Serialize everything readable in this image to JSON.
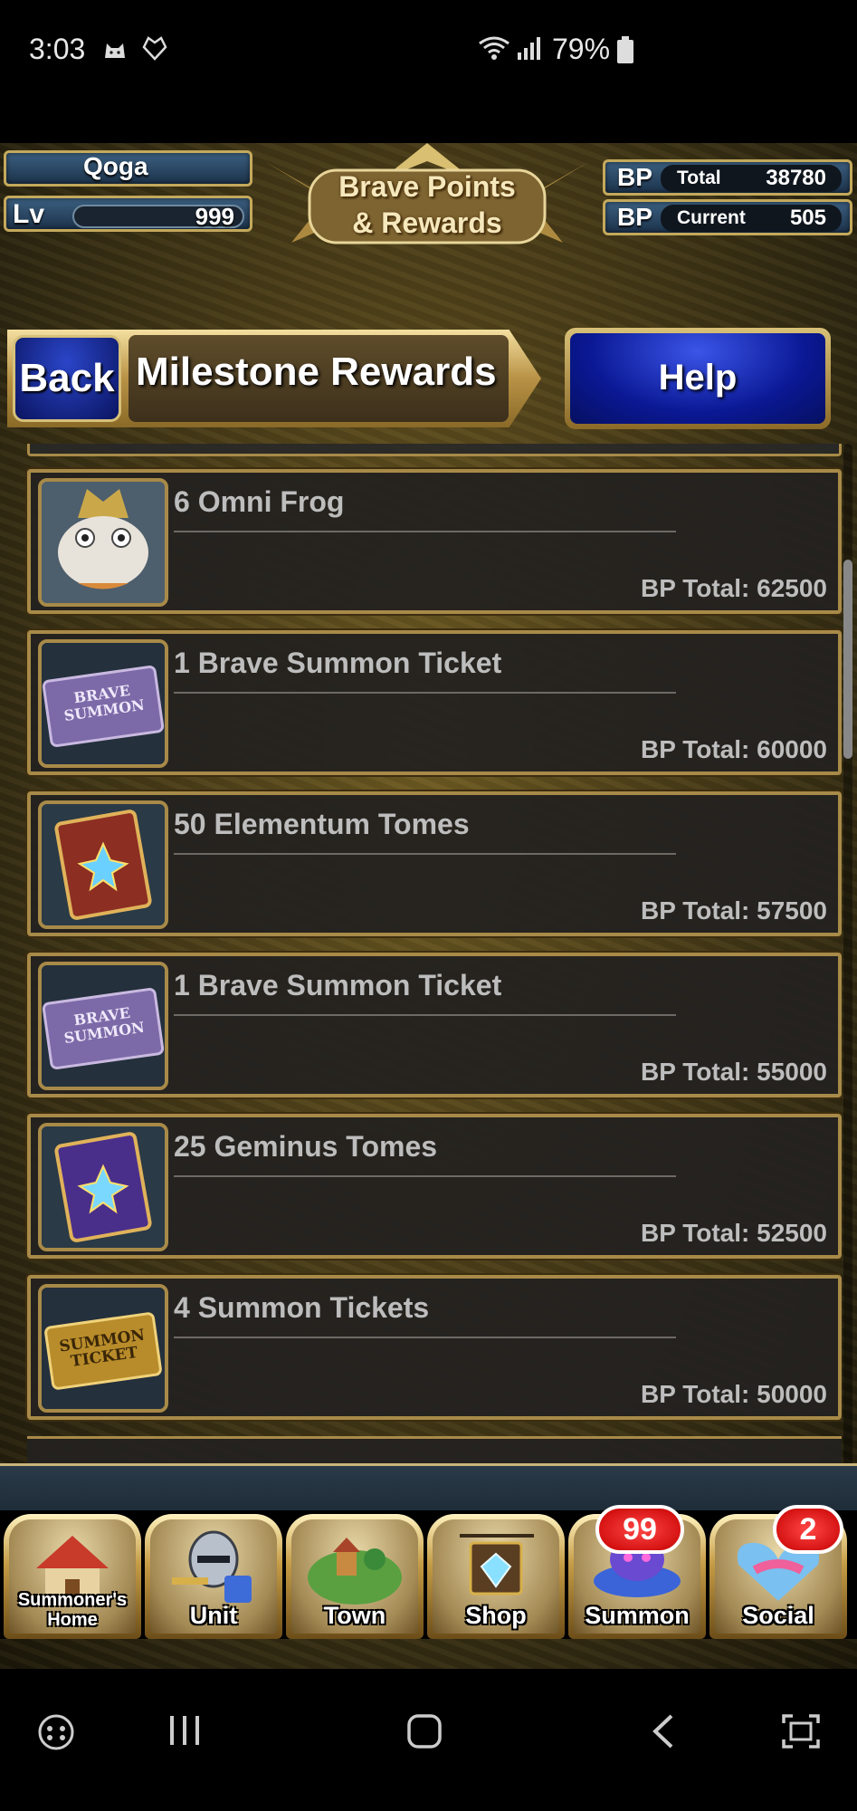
{
  "status_bar": {
    "time": "3:03",
    "battery_percent": "79%",
    "icons": [
      "cat-notification-icon",
      "heart-notification-icon",
      "wifi-icon",
      "signal-icon",
      "battery-icon"
    ]
  },
  "header": {
    "player_name": "Qoga",
    "level_label": "Lv",
    "level_value": "999",
    "title_line1": "Brave Points",
    "title_line2": "& Rewards",
    "bp_total_label": "BP",
    "bp_total_key": "Total",
    "bp_total_value": "38780",
    "bp_current_label": "BP",
    "bp_current_key": "Current",
    "bp_current_value": "505"
  },
  "nav": {
    "back_label": "Back",
    "page_title": "Milestone Rewards",
    "help_label": "Help"
  },
  "rewards": [
    {
      "name": "6 Omni Frog",
      "bp": "BP Total: 62500",
      "icon": "omni-frog-icon"
    },
    {
      "name": "1 Brave Summon Ticket",
      "bp": "BP Total: 60000",
      "icon": "brave-summon-ticket-icon",
      "icon_text": "BRAVE SUMMON"
    },
    {
      "name": "50 Elementum Tomes",
      "bp": "BP Total: 57500",
      "icon": "elementum-tome-icon"
    },
    {
      "name": "1 Brave Summon Ticket",
      "bp": "BP Total: 55000",
      "icon": "brave-summon-ticket-icon",
      "icon_text": "BRAVE SUMMON"
    },
    {
      "name": "25 Geminus Tomes",
      "bp": "BP Total: 52500",
      "icon": "geminus-tome-icon"
    },
    {
      "name": "4 Summon Tickets",
      "bp": "BP Total: 50000",
      "icon": "summon-ticket-icon",
      "icon_text": "SUMMON TICKET"
    }
  ],
  "menu": {
    "summoners_home_line1": "Summoner's",
    "summoners_home_line2": "Home",
    "unit": "Unit",
    "town": "Town",
    "shop": "Shop",
    "summon": "Summon",
    "summon_badge": "99",
    "social": "Social",
    "social_badge": "2"
  },
  "colors": {
    "gold_border": "#a88a48",
    "blue_button": "#0a1894",
    "badge_red": "#d40000",
    "row_bg": "#242220",
    "text_dim": "#bdbdbd"
  }
}
